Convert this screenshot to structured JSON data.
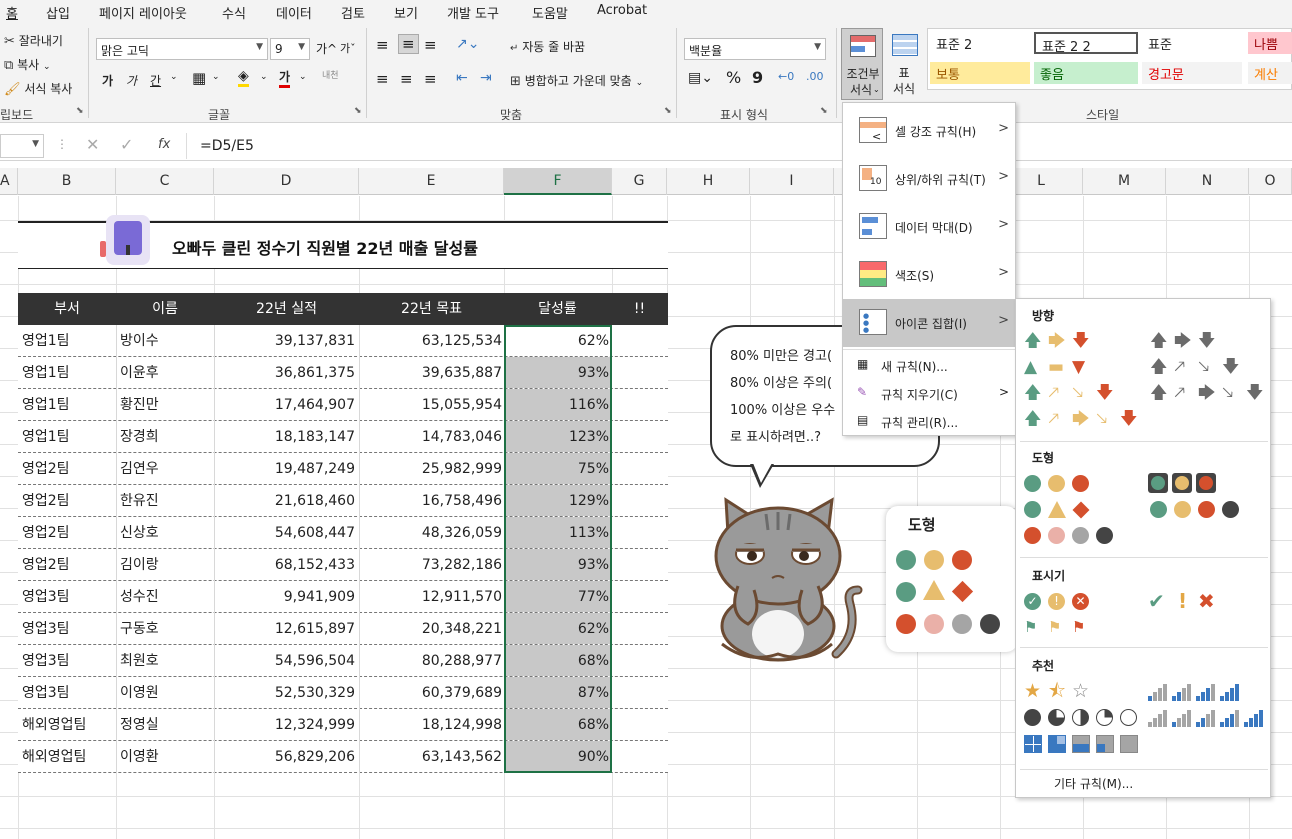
{
  "menu_tabs": [
    "홈",
    "삽입",
    "페이지 레이아웃",
    "수식",
    "데이터",
    "검토",
    "보기",
    "개발 도구",
    "도움말",
    "Acrobat"
  ],
  "ribbon": {
    "clipboard": {
      "cut": "잘라내기",
      "copy": "복사",
      "format_painter": "서식 복사",
      "label": "립보드"
    },
    "font": {
      "name": "맑은 고딕",
      "size": "9",
      "label": "글꼴",
      "bold": "가",
      "italic": "가",
      "underline": "간",
      "grow": "가^",
      "shrink": "가ˇ",
      "font_color": "가"
    },
    "align": {
      "wrap": "자동 줄 바꿈",
      "merge": "병합하고 가운데 맞춤",
      "label": "맞춤"
    },
    "number": {
      "format": "백분율",
      "label": "표시 형식",
      "pct": "%",
      "comma": "9"
    },
    "styles": {
      "cond_label_1": "조건부",
      "cond_label_2": "서식",
      "table_label_1": "표",
      "table_label_2": "서식",
      "label": "스타일",
      "cells": [
        {
          "name": "표준 2",
          "bg": "#ffffff",
          "fg": "#222222"
        },
        {
          "name": "표준 2 2",
          "bg": "#ffffff",
          "fg": "#222222"
        },
        {
          "name": "표준",
          "bg": "#ffffff",
          "fg": "#222222"
        },
        {
          "name": "나쁨",
          "bg": "#ffc7ce",
          "fg": "#9c0006"
        },
        {
          "name": "보통",
          "bg": "#ffeb9c",
          "fg": "#9c5700"
        },
        {
          "name": "좋음",
          "bg": "#c6efce",
          "fg": "#006100"
        },
        {
          "name": "경고문",
          "bg": "#f3f3f3",
          "fg": "#e00000"
        },
        {
          "name": "계산",
          "bg": "#f2f2f2",
          "fg": "#fa7d00"
        }
      ]
    }
  },
  "formula": {
    "fx": "fx",
    "content": "=D5/E5"
  },
  "columns": [
    "A",
    "B",
    "C",
    "D",
    "E",
    "F",
    "G",
    "H",
    "I",
    "J",
    "K",
    "L",
    "M",
    "N",
    "O"
  ],
  "sheet": {
    "title": "오빠두 클린 정수기 직원별 22년 매출 달성률",
    "headers": [
      "부서",
      "이름",
      "22년 실적",
      "22년 목표",
      "달성률",
      "!!"
    ],
    "rows": [
      [
        "영업1팀",
        "방이수",
        "39,137,831",
        "63,125,534",
        "62%"
      ],
      [
        "영업1팀",
        "이윤후",
        "36,861,375",
        "39,635,887",
        "93%"
      ],
      [
        "영업1팀",
        "황진만",
        "17,464,907",
        "15,055,954",
        "116%"
      ],
      [
        "영업1팀",
        "장경희",
        "18,183,147",
        "14,783,046",
        "123%"
      ],
      [
        "영업2팀",
        "김연우",
        "19,487,249",
        "25,982,999",
        "75%"
      ],
      [
        "영업2팀",
        "한유진",
        "21,618,460",
        "16,758,496",
        "129%"
      ],
      [
        "영업2팀",
        "신상호",
        "54,608,447",
        "48,326,059",
        "113%"
      ],
      [
        "영업2팀",
        "김이랑",
        "68,152,433",
        "73,282,186",
        "93%"
      ],
      [
        "영업3팀",
        "성수진",
        "9,941,909",
        "12,911,570",
        "77%"
      ],
      [
        "영업3팀",
        "구동호",
        "12,615,897",
        "20,348,221",
        "62%"
      ],
      [
        "영업3팀",
        "최원호",
        "54,596,504",
        "80,288,977",
        "68%"
      ],
      [
        "영업3팀",
        "이영원",
        "52,530,329",
        "60,379,689",
        "87%"
      ],
      [
        "해외영업팀",
        "정영실",
        "12,324,999",
        "18,124,998",
        "68%"
      ],
      [
        "해외영업팀",
        "이영환",
        "56,829,206",
        "63,143,562",
        "90%"
      ]
    ]
  },
  "cf_menu": {
    "items": [
      "셀 강조 규칙(H)",
      "상위/하위 규칙(T)",
      "데이터 막대(D)",
      "색조(S)",
      "아이콘 집합(I)"
    ],
    "small": [
      "새 규칙(N)...",
      "규칙 지우기(C)",
      "규칙 관리(R)..."
    ],
    "icon10": "10"
  },
  "icon_sets": {
    "direction": "방향",
    "shapes": "도형",
    "indicators": "표시기",
    "ratings": "추천",
    "more": "기타 규칙(M)..."
  },
  "bubble": [
    "80% 미만은 경고(",
    "80% 이상은 주의(",
    "100% 이상은 우수",
    "로 표시하려면..?"
  ],
  "shape_card": {
    "title": "도형"
  },
  "colors": {
    "green": "#5a9c82",
    "yellow": "#e7bd6e",
    "red": "#d4502d",
    "pink": "#eab0a8",
    "gray": "#a5a5a5",
    "dark": "#444444",
    "orange": "#e3a745",
    "blue": "#3a78c0"
  }
}
